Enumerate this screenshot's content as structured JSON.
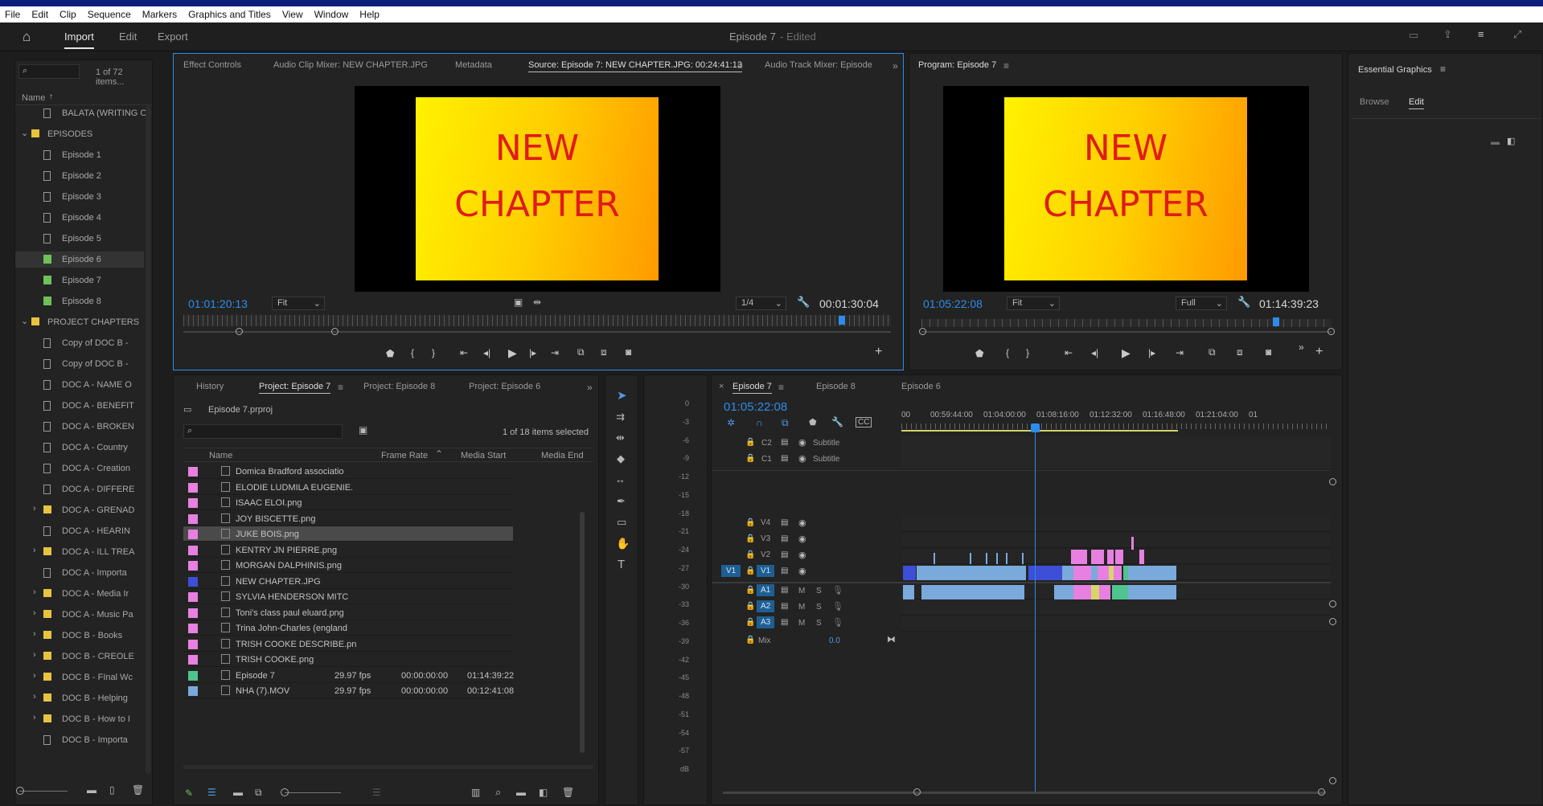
{
  "menu": [
    "File",
    "Edit",
    "Clip",
    "Sequence",
    "Markers",
    "Graphics and Titles",
    "View",
    "Window",
    "Help"
  ],
  "workspace": {
    "tabs": [
      "Import",
      "Edit",
      "Export"
    ],
    "active_tab": "Import",
    "title": "Episode 7",
    "title_status": "- Edited"
  },
  "bin": {
    "count": "1 of 72 items...",
    "name_header": "Name",
    "items": [
      {
        "label": "BALATA (WRITING OF",
        "type": "doc",
        "depth": 1
      },
      {
        "label": "EPISODES",
        "type": "folder",
        "depth": 0,
        "open": true
      },
      {
        "label": "Episode 1",
        "type": "doc",
        "depth": 1
      },
      {
        "label": "Episode 2",
        "type": "doc",
        "depth": 1
      },
      {
        "label": "Episode 3",
        "type": "doc",
        "depth": 1
      },
      {
        "label": "Episode 4",
        "type": "doc",
        "depth": 1
      },
      {
        "label": "Episode 5",
        "type": "doc",
        "depth": 1
      },
      {
        "label": "Episode 6",
        "type": "edited",
        "depth": 1,
        "selected": true
      },
      {
        "label": "Episode 7",
        "type": "edited",
        "depth": 1
      },
      {
        "label": "Episode 8",
        "type": "edited",
        "depth": 1
      },
      {
        "label": "PROJECT CHAPTERS",
        "type": "folder",
        "depth": 0,
        "open": true
      },
      {
        "label": "Copy of DOC B -",
        "type": "doc",
        "depth": 1
      },
      {
        "label": "Copy of DOC B -",
        "type": "doc",
        "depth": 1
      },
      {
        "label": "DOC A - NAME O",
        "type": "doc",
        "depth": 1
      },
      {
        "label": "DOC A - BENEFIT",
        "type": "doc",
        "depth": 1
      },
      {
        "label": "DOC A - BROKEN",
        "type": "doc",
        "depth": 1
      },
      {
        "label": "DOC A - Country",
        "type": "doc",
        "depth": 1
      },
      {
        "label": "DOC A - Creation",
        "type": "doc",
        "depth": 1
      },
      {
        "label": "DOC A - DIFFERE",
        "type": "doc",
        "depth": 1
      },
      {
        "label": "DOC A - GRENAD",
        "type": "folder",
        "depth": 1
      },
      {
        "label": "DOC A - HEARIN",
        "type": "doc",
        "depth": 1
      },
      {
        "label": "DOC A - ILL TREA",
        "type": "folder",
        "depth": 1
      },
      {
        "label": "DOC A - Importa",
        "type": "doc",
        "depth": 1
      },
      {
        "label": "DOC A - Media Ir",
        "type": "folder",
        "depth": 1
      },
      {
        "label": "DOC A - Music Pa",
        "type": "folder",
        "depth": 1
      },
      {
        "label": "DOC B - Books",
        "type": "folder",
        "depth": 1
      },
      {
        "label": "DOC B - CREOLE",
        "type": "folder",
        "depth": 1
      },
      {
        "label": "DOC B - FInal Wc",
        "type": "folder",
        "depth": 1
      },
      {
        "label": "DOC B - Helping",
        "type": "folder",
        "depth": 1
      },
      {
        "label": "DOC B - How to I",
        "type": "folder",
        "depth": 1
      },
      {
        "label": "DOC B - Importa",
        "type": "doc",
        "depth": 1
      }
    ]
  },
  "source": {
    "tabs": [
      "Effect Controls",
      "Audio Clip Mixer: NEW CHAPTER.JPG",
      "Metadata",
      "Source: Episode 7: NEW CHAPTER.JPG: 00:24:41:13",
      "Audio Track Mixer: Episode"
    ],
    "active_tab": 3,
    "card_line1": "NEW",
    "card_line2": "CHAPTER",
    "timecode": "01:01:20:13",
    "fit": "Fit",
    "resolution": "1/4",
    "duration": "00:01:30:04"
  },
  "program": {
    "tab": "Program: Episode 7",
    "card_line1": "NEW",
    "card_line2": "CHAPTER",
    "timecode": "01:05:22:08",
    "fit": "Fit",
    "resolution": "Full",
    "duration": "01:14:39:23"
  },
  "essential": {
    "title": "Essential Graphics",
    "tabs": [
      "Browse",
      "Edit"
    ],
    "active_tab": "Edit"
  },
  "project": {
    "tabs": [
      "History",
      "Project: Episode 7",
      "Project: Episode 8",
      "Project: Episode 6"
    ],
    "active_tab": 1,
    "file": "Episode 7.prproj",
    "selection": "1 of 18 items selected",
    "columns": [
      "Name",
      "Frame Rate",
      "Media Start",
      "Media End"
    ],
    "rows": [
      {
        "name": "Domica Bradford associatio",
        "color": "#e780e0",
        "frame_rate": "",
        "start": "",
        "end": ""
      },
      {
        "name": "ELODIE LUDMILA EUGENIE.",
        "color": "#e780e0",
        "frame_rate": "",
        "start": "",
        "end": ""
      },
      {
        "name": "ISAAC ELOI.png",
        "color": "#e780e0",
        "frame_rate": "",
        "start": "",
        "end": ""
      },
      {
        "name": "JOY BISCETTE.png",
        "color": "#e780e0",
        "frame_rate": "",
        "start": "",
        "end": ""
      },
      {
        "name": "JUKE BOIS.png",
        "color": "#e780e0",
        "frame_rate": "",
        "start": "",
        "end": "",
        "selected": true
      },
      {
        "name": "KENTRY JN PIERRE.png",
        "color": "#e780e0",
        "frame_rate": "",
        "start": "",
        "end": ""
      },
      {
        "name": "MORGAN DALPHINIS.png",
        "color": "#e780e0",
        "frame_rate": "",
        "start": "",
        "end": ""
      },
      {
        "name": "NEW CHAPTER.JPG",
        "color": "#3c4fd6",
        "frame_rate": "",
        "start": "",
        "end": ""
      },
      {
        "name": "SYLVIA HENDERSON MITC",
        "color": "#e780e0",
        "frame_rate": "",
        "start": "",
        "end": ""
      },
      {
        "name": "Toni's class paul eluard.png",
        "color": "#e780e0",
        "frame_rate": "",
        "start": "",
        "end": ""
      },
      {
        "name": "Trina John-Charles (england",
        "color": "#e780e0",
        "frame_rate": "",
        "start": "",
        "end": ""
      },
      {
        "name": "TRISH COOKE DESCRIBE.pn",
        "color": "#e780e0",
        "frame_rate": "",
        "start": "",
        "end": ""
      },
      {
        "name": "TRISH COOKE.png",
        "color": "#e780e0",
        "frame_rate": "",
        "start": "",
        "end": ""
      },
      {
        "name": "Episode 7",
        "color": "#4fc48e",
        "frame_rate": "29.97 fps",
        "start": "00:00:00:00",
        "end": "01:14:39:22"
      },
      {
        "name": "NHA (7).MOV",
        "color": "#7aa9dc",
        "frame_rate": "29.97 fps",
        "start": "00:00:00:00",
        "end": "00:12:41:08"
      }
    ]
  },
  "meter": {
    "ticks": [
      "0",
      "-3",
      "-6",
      "-9",
      "-12",
      "-15",
      "-18",
      "-21",
      "-24",
      "-27",
      "-30",
      "-33",
      "-36",
      "-39",
      "-42",
      "-45",
      "-48",
      "-51",
      "-54",
      "-57",
      "dB"
    ]
  },
  "timeline": {
    "tabs": [
      "Episode 7",
      "Episode 8",
      "Episode 6"
    ],
    "active_tab": 0,
    "timecode": "01:05:22:08",
    "ruler": [
      "00",
      "00:59:44:00",
      "01:04:00:00",
      "01:08:16:00",
      "01:12:32:00",
      "01:16:48:00",
      "01:21:04:00",
      "01"
    ],
    "caption_tracks": [
      {
        "id": "C2",
        "label": "Subtitle"
      },
      {
        "id": "C1",
        "label": "Subtitle"
      }
    ],
    "video_tracks": [
      "V4",
      "V3",
      "V2",
      "V1"
    ],
    "audio_tracks": [
      "A1",
      "A2",
      "A3"
    ],
    "source_patch": "V1",
    "mix_label": "Mix",
    "mix_value": "0.0",
    "m_label": "M",
    "s_label": "S"
  }
}
